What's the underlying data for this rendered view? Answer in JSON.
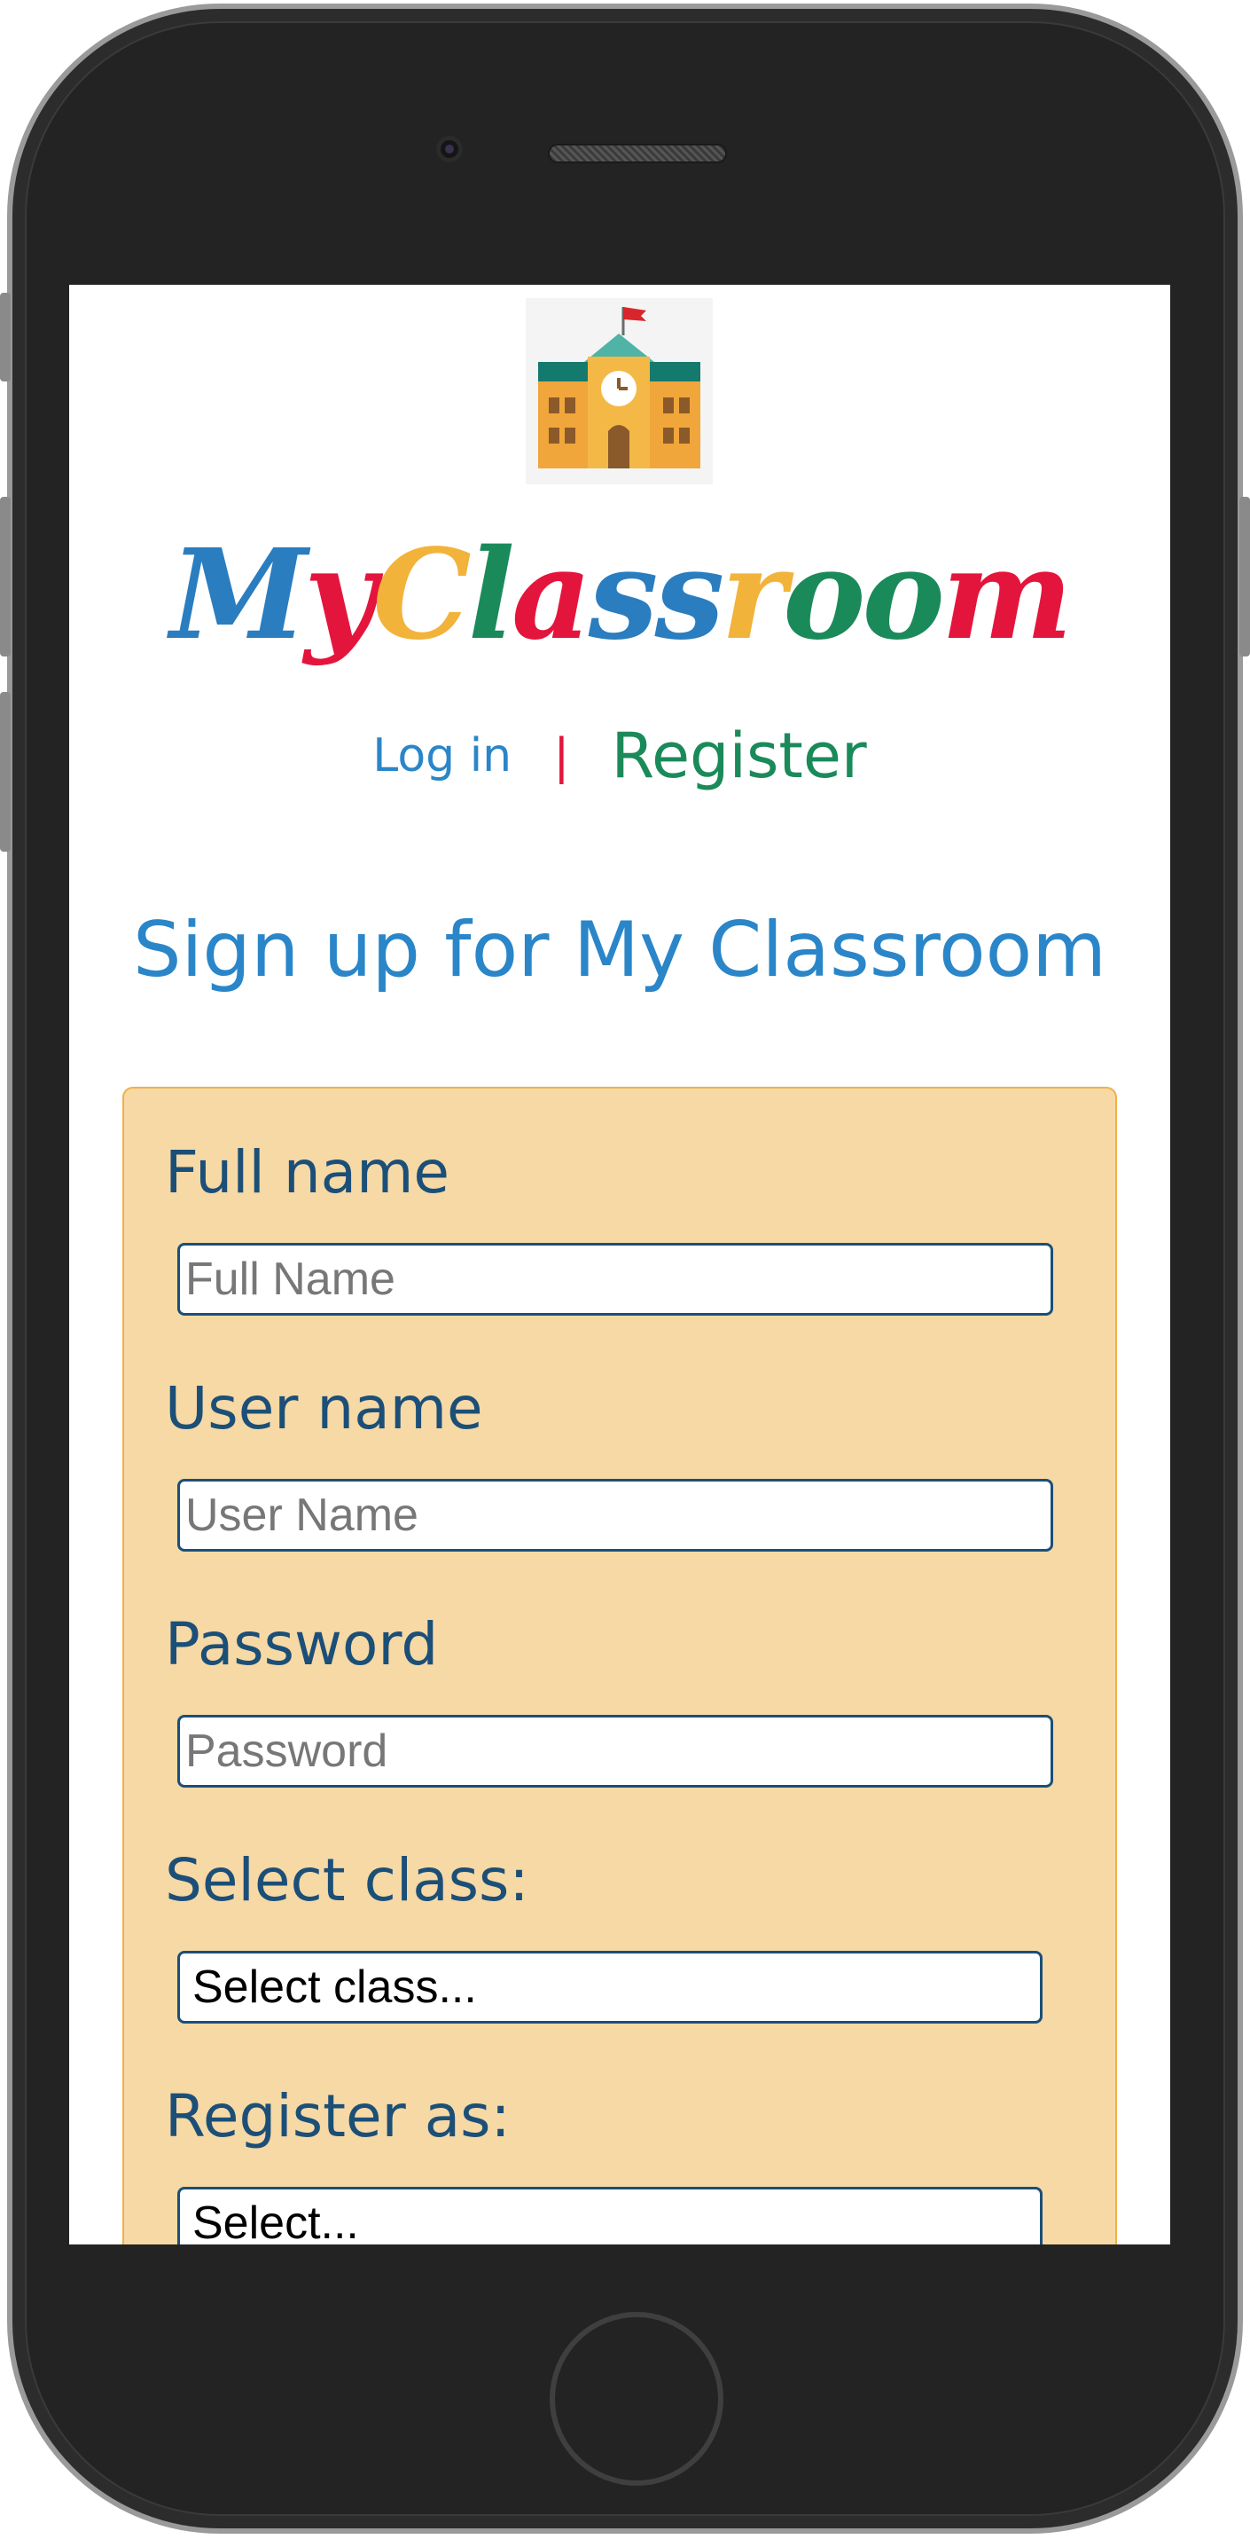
{
  "app": {
    "brand_letters": [
      {
        "ch": "M",
        "color": "#2a7dbf"
      },
      {
        "ch": "y",
        "color": "#e4153c"
      },
      {
        "ch": "C",
        "color": "#f2b33a"
      },
      {
        "ch": "l",
        "color": "#1b8a5a"
      },
      {
        "ch": "a",
        "color": "#e4153c"
      },
      {
        "ch": "s",
        "color": "#2a7dbf"
      },
      {
        "ch": "s",
        "color": "#2a7dbf"
      },
      {
        "ch": "r",
        "color": "#f2b33a"
      },
      {
        "ch": "o",
        "color": "#1b8a5a"
      },
      {
        "ch": "o",
        "color": "#1b8a5a"
      },
      {
        "ch": "m",
        "color": "#e4153c"
      }
    ]
  },
  "nav": {
    "login_label": "Log in",
    "separator": "|",
    "register_label": "Register"
  },
  "page": {
    "title": "Sign up for My Classroom"
  },
  "form": {
    "full_name": {
      "label": "Full name",
      "placeholder": "Full Name",
      "value": ""
    },
    "user_name": {
      "label": "User name",
      "placeholder": "User Name",
      "value": ""
    },
    "password": {
      "label": "Password",
      "placeholder": "Password",
      "value": ""
    },
    "class_select": {
      "label": "Select class:",
      "selected": "Select class..."
    },
    "role_select": {
      "label": "Register as:",
      "selected": "Select..."
    }
  },
  "colors": {
    "accent_blue": "#2a86c8",
    "accent_green": "#1b8a5a",
    "accent_red": "#e4153c",
    "form_bg": "#f6d9a5",
    "form_label": "#1c4f78"
  },
  "icons": {
    "logo": "school-building-icon"
  }
}
